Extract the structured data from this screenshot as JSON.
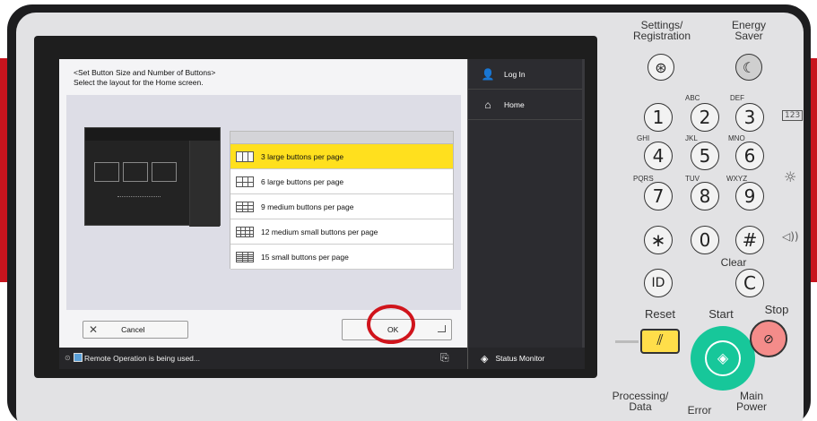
{
  "screen": {
    "header_line1": "<Set Button Size and Number of Buttons>",
    "header_line2": "Select the layout for the Home screen.",
    "options": [
      {
        "label": "3 large buttons per page",
        "selected": true
      },
      {
        "label": "6 large buttons per page",
        "selected": false
      },
      {
        "label": "9 medium buttons per page",
        "selected": false
      },
      {
        "label": "12 medium small buttons per page",
        "selected": false
      },
      {
        "label": "15 small buttons per page",
        "selected": false
      }
    ],
    "cancel_label": "Cancel",
    "ok_label": "OK",
    "status_text": "Remote Operation is being used...",
    "status_monitor_label": "Status Monitor",
    "side": {
      "login_label": "Log In",
      "home_label": "Home"
    }
  },
  "keypad": {
    "settings_label_1": "Settings/",
    "settings_label_2": "Registration",
    "energy_label_1": "Energy",
    "energy_label_2": "Saver",
    "keys": [
      {
        "digit": "1",
        "letters": ""
      },
      {
        "digit": "2",
        "letters": "ABC"
      },
      {
        "digit": "3",
        "letters": "DEF"
      },
      {
        "digit": "4",
        "letters": "GHI"
      },
      {
        "digit": "5",
        "letters": "JKL"
      },
      {
        "digit": "6",
        "letters": "MNO"
      },
      {
        "digit": "7",
        "letters": "PQRS"
      },
      {
        "digit": "8",
        "letters": "TUV"
      },
      {
        "digit": "9",
        "letters": "WXYZ"
      }
    ],
    "zero": "0",
    "star_symbol": "∗",
    "hash_symbol": "#",
    "clear_label": "Clear",
    "clear_key": "C",
    "id_key": "ID",
    "reset_label": "Reset",
    "start_label": "Start",
    "stop_label": "Stop",
    "processing_label_1": "Processing/",
    "processing_label_2": "Data",
    "error_label": "Error",
    "main_power_label_1": "Main",
    "main_power_label_2": "Power"
  },
  "colors": {
    "selected_row": "#ffe01e",
    "start_button": "#17c79a",
    "stop_button": "#f48c8a",
    "reset_button": "#ffde4a",
    "highlight_ring": "#d0141c"
  }
}
